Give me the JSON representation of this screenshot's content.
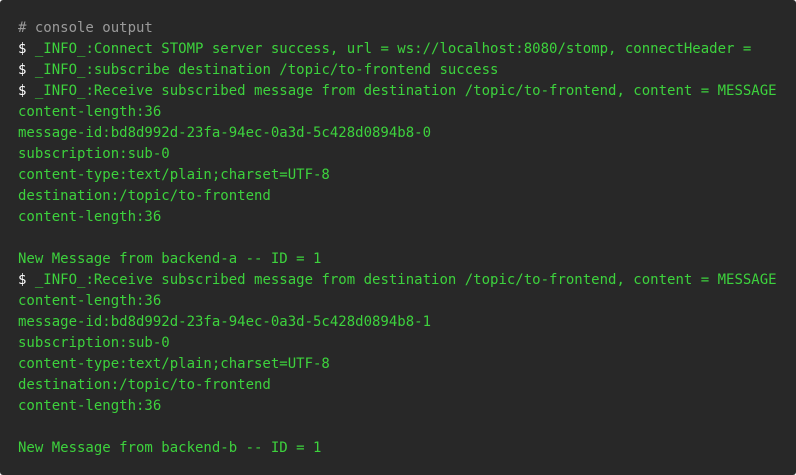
{
  "console": {
    "comment": "# console output",
    "prompt_symbol": "$",
    "lines": [
      {
        "kind": "comment",
        "text": "# console output"
      },
      {
        "kind": "prompt",
        "text": " _INFO_:Connect STOMP server success, url = ws://localhost:8080/stomp, connectHeader ="
      },
      {
        "kind": "prompt",
        "text": " _INFO_:subscribe destination /topic/to-frontend success"
      },
      {
        "kind": "prompt",
        "text": " _INFO_:Receive subscribed message from destination /topic/to-frontend, content = MESSAGE"
      },
      {
        "kind": "text",
        "text": "content-length:36"
      },
      {
        "kind": "text",
        "text": "message-id:bd8d992d-23fa-94ec-0a3d-5c428d0894b8-0"
      },
      {
        "kind": "text",
        "text": "subscription:sub-0"
      },
      {
        "kind": "text",
        "text": "content-type:text/plain;charset=UTF-8"
      },
      {
        "kind": "text",
        "text": "destination:/topic/to-frontend"
      },
      {
        "kind": "text",
        "text": "content-length:36"
      },
      {
        "kind": "blank",
        "text": ""
      },
      {
        "kind": "text",
        "text": "New Message from backend-a -- ID = 1"
      },
      {
        "kind": "prompt",
        "text": " _INFO_:Receive subscribed message from destination /topic/to-frontend, content = MESSAGE"
      },
      {
        "kind": "text",
        "text": "content-length:36"
      },
      {
        "kind": "text",
        "text": "message-id:bd8d992d-23fa-94ec-0a3d-5c428d0894b8-1"
      },
      {
        "kind": "text",
        "text": "subscription:sub-0"
      },
      {
        "kind": "text",
        "text": "content-type:text/plain;charset=UTF-8"
      },
      {
        "kind": "text",
        "text": "destination:/topic/to-frontend"
      },
      {
        "kind": "text",
        "text": "content-length:36"
      },
      {
        "kind": "blank",
        "text": ""
      },
      {
        "kind": "text",
        "text": "New Message from backend-b -- ID = 1"
      }
    ]
  },
  "colors": {
    "background": "#282828",
    "message_text": "#3dd23d",
    "prompt": "#ffffff",
    "comment": "#9a9a9a"
  }
}
